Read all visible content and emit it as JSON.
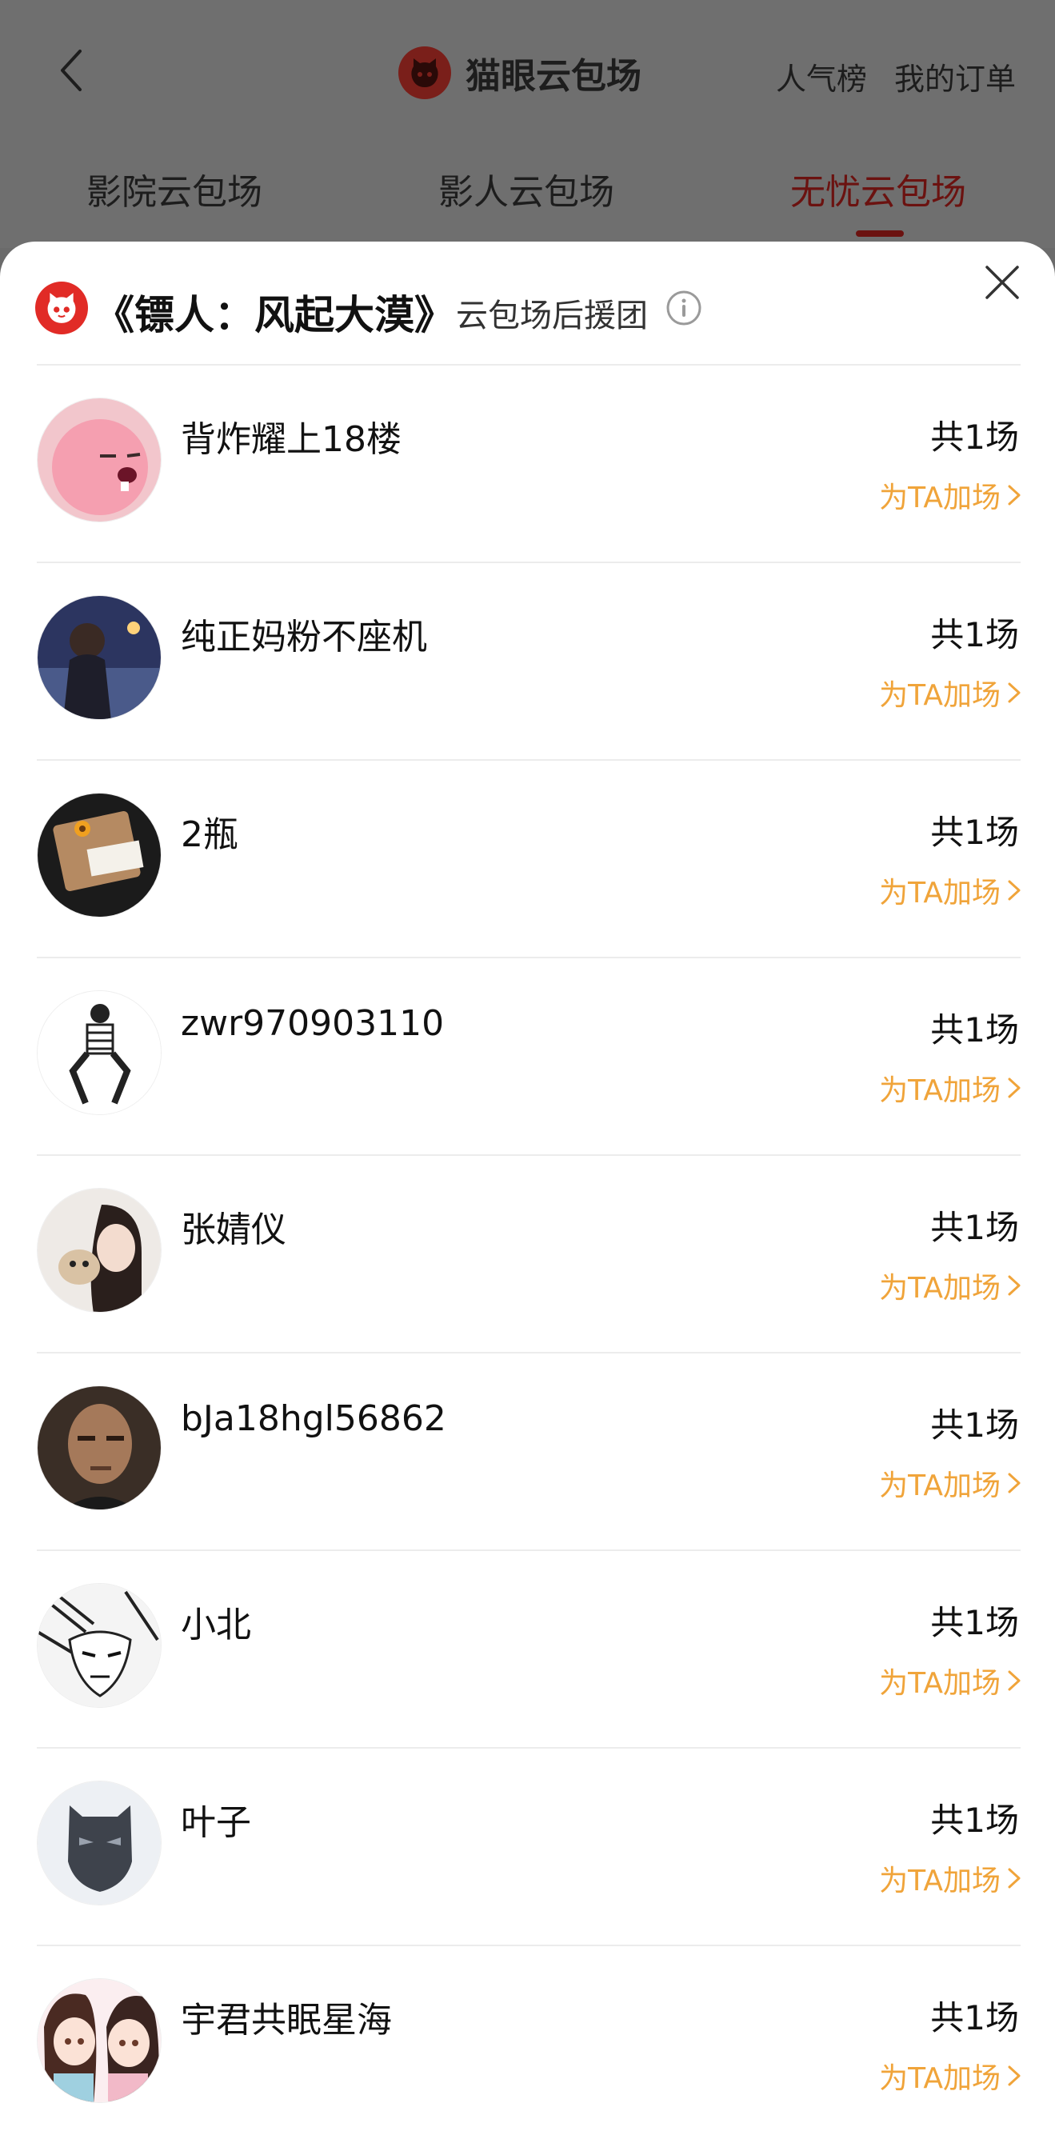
{
  "header": {
    "app_title": "猫眼云包场",
    "links": [
      "人气榜",
      "我的订单"
    ],
    "tabs": [
      {
        "label": "影院云包场",
        "active": false
      },
      {
        "label": "影人云包场",
        "active": false
      },
      {
        "label": "无忧云包场",
        "active": true
      }
    ]
  },
  "sheet": {
    "title": "《镖人：风起大漠》",
    "subtitle": "云包场后援团"
  },
  "rows": [
    {
      "name": "背炸耀上18楼",
      "count": "共1场",
      "action": "为TA加场",
      "avatar": "pink-character"
    },
    {
      "name": "纯正妈粉不座机",
      "count": "共1场",
      "action": "为TA加场",
      "avatar": "person-dark"
    },
    {
      "name": "2瓶",
      "count": "共1场",
      "action": "为TA加场",
      "avatar": "envelope-flower"
    },
    {
      "name": "zwr970903110",
      "count": "共1场",
      "action": "为TA加场",
      "avatar": "sketch-figure"
    },
    {
      "name": "张婧仪",
      "count": "共1场",
      "action": "为TA加场",
      "avatar": "woman-with-dog"
    },
    {
      "name": "bJa18hgl56862",
      "count": "共1场",
      "action": "为TA加场",
      "avatar": "man-portrait"
    },
    {
      "name": "小北",
      "count": "共1场",
      "action": "为TA加场",
      "avatar": "manga-face"
    },
    {
      "name": "叶子",
      "count": "共1场",
      "action": "为TA加场",
      "avatar": "mask"
    },
    {
      "name": "宇君共眠星海",
      "count": "共1场",
      "action": "为TA加场",
      "avatar": "two-anime-girls"
    }
  ],
  "colors": {
    "accent": "#e12b26",
    "action": "#f0a43a",
    "active_tab": "#6b1210"
  }
}
